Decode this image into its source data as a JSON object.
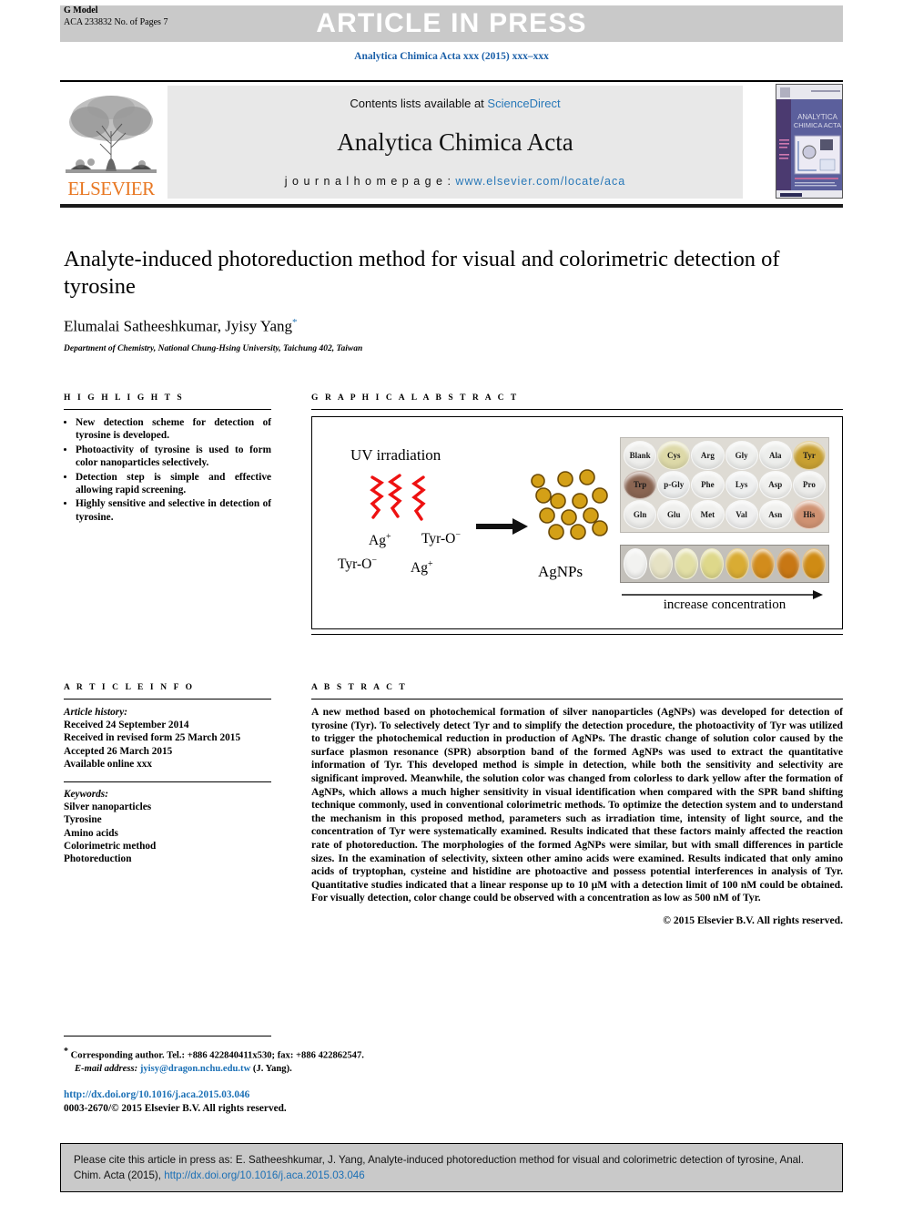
{
  "header": {
    "g_model_line1": "G Model",
    "g_model_line2": "ACA 233832 No. of Pages 7",
    "press_banner": "ARTICLE IN PRESS",
    "journal_ref": "Analytica Chimica Acta xxx (2015) xxx–xxx"
  },
  "masthead": {
    "contents_prefix": "Contents lists available at ",
    "sciencedirect": "ScienceDirect",
    "journal_title": "Analytica Chimica Acta",
    "homepage_prefix": "j o u r n a l  h o m e p a g e :  ",
    "homepage_url": "www.elsevier.com/locate/aca",
    "publisher": "ELSEVIER",
    "cover_title_line1": "ANALYTICA",
    "cover_title_line2": "CHIMICA ACTA"
  },
  "article": {
    "title": "Analyte-induced photoreduction method for visual and colorimetric detection of tyrosine",
    "authors": "Elumalai Satheeshkumar, Jyisy Yang",
    "corresponding_marker": "*",
    "affiliation": "Department of Chemistry, National Chung-Hsing University, Taichung 402, Taiwan"
  },
  "highlights": {
    "heading": "H I G H L I G H T S",
    "items": [
      "New detection scheme for detection of tyrosine is developed.",
      "Photoactivity of tyrosine is used to form color nanoparticles selectively.",
      "Detection step is simple and effective allowing rapid screening.",
      "Highly sensitive and selective in detection of tyrosine."
    ]
  },
  "graphical_abstract": {
    "heading": "G R A P H I C A L   A B S T R A C T",
    "uv_label": "UV irradiation",
    "reactant_ag_1": "Ag",
    "reactant_ag_1_charge": "+",
    "reactant_tyr_1": "Tyr-O",
    "reactant_tyr_1_charge": "−",
    "reactant_tyr_2": "Tyr-O",
    "reactant_tyr_2_charge": "−",
    "reactant_ag_2": "Ag",
    "reactant_ag_2_charge": "+",
    "product_label": "AgNPs",
    "concentration_label": "increase concentration",
    "nanoparticle_color": "#d4a017",
    "uv_ray_color": "#ee1111",
    "plate_wells": [
      {
        "label": "Blank",
        "color": "#eeeeec"
      },
      {
        "label": "Cys",
        "color": "#ddd9a8"
      },
      {
        "label": "Arg",
        "color": "#ecedeb"
      },
      {
        "label": "Gly",
        "color": "#eeefed"
      },
      {
        "label": "Ala",
        "color": "#edeeec"
      },
      {
        "label": "Tyr",
        "color": "#c8a032"
      },
      {
        "label": "Trp",
        "color": "#8a6552"
      },
      {
        "label": "p-Gly",
        "color": "#eceded"
      },
      {
        "label": "Phe",
        "color": "#efefed"
      },
      {
        "label": "Lys",
        "color": "#eeefef"
      },
      {
        "label": "Asp",
        "color": "#f0f0ee"
      },
      {
        "label": "Pro",
        "color": "#ececea"
      },
      {
        "label": "Gln",
        "color": "#eeeeec"
      },
      {
        "label": "Glu",
        "color": "#efefed"
      },
      {
        "label": "Met",
        "color": "#f0f0ee"
      },
      {
        "label": "Val",
        "color": "#efefef"
      },
      {
        "label": "Asn",
        "color": "#f0f0ee"
      },
      {
        "label": "His",
        "color": "#cf9272"
      }
    ],
    "gradient_wells": [
      {
        "color": "#f2f2f0"
      },
      {
        "color": "#e6e2c4"
      },
      {
        "color": "#e2dfa6"
      },
      {
        "color": "#ded88a"
      },
      {
        "color": "#d9ac33"
      },
      {
        "color": "#d28c1c"
      },
      {
        "color": "#c87714"
      },
      {
        "color": "#cf8b14"
      }
    ]
  },
  "article_info": {
    "heading": "A R T I C L E   I N F O",
    "history_label": "Article history:",
    "history": [
      "Received 24 September 2014",
      "Received in revised form 25 March 2015",
      "Accepted 26 March 2015",
      "Available online xxx"
    ],
    "keywords_label": "Keywords:",
    "keywords": [
      "Silver nanoparticles",
      "Tyrosine",
      "Amino acids",
      "Colorimetric method",
      "Photoreduction"
    ]
  },
  "abstract": {
    "heading": "A B S T R A C T",
    "body": "A new method based on photochemical formation of silver nanoparticles (AgNPs) was developed for detection of tyrosine (Tyr). To selectively detect Tyr and to simplify the detection procedure, the photoactivity of Tyr was utilized to trigger the photochemical reduction in production of AgNPs. The drastic change of solution color caused by the surface plasmon resonance (SPR) absorption band of the formed AgNPs was used to extract the quantitative information of Tyr. This developed method is simple in detection, while both the sensitivity and selectivity are significant improved. Meanwhile, the solution color was changed from colorless to dark yellow after the formation of AgNPs, which allows a much higher sensitivity in visual identification when compared with the SPR band shifting technique commonly, used in conventional colorimetric methods. To optimize the detection system and to understand the mechanism in this proposed method, parameters such as irradiation time, intensity of light source, and the concentration of Tyr were systematically examined. Results indicated that these factors mainly affected the reaction rate of photoreduction. The morphologies of the formed AgNPs were similar, but with small differences in particle sizes. In the examination of selectivity, sixteen other amino acids were examined. Results indicated that only amino acids of tryptophan, cysteine and histidine are photoactive and possess potential interferences in analysis of Tyr. Quantitative studies indicated that a linear response up to 10 μM with a detection limit of 100 nM could be obtained. For visually detection, color change could be observed with a concentration as low as 500 nM of Tyr.",
    "copyright": "© 2015 Elsevier B.V. All rights reserved."
  },
  "footnotes": {
    "corresponding_marker": "*",
    "corresponding_text": "Corresponding author. Tel.: +886 422840411x530; fax: +886 422862547.",
    "email_label": "E-mail address:",
    "email": "jyisy@dragon.nchu.edu.tw",
    "email_suffix": "(J. Yang).",
    "doi": "http://dx.doi.org/10.1016/j.aca.2015.03.046",
    "issn_copyright": "0003-2670/© 2015 Elsevier B.V. All rights reserved."
  },
  "citation_box": {
    "text_part1": "Please cite this article in press as: E. Satheeshkumar, J. Yang, Analyte-induced photoreduction method for visual and colorimetric detection of tyrosine, Anal. Chim. Acta (2015), ",
    "link": "http://dx.doi.org/10.1016/j.aca.2015.03.046"
  }
}
